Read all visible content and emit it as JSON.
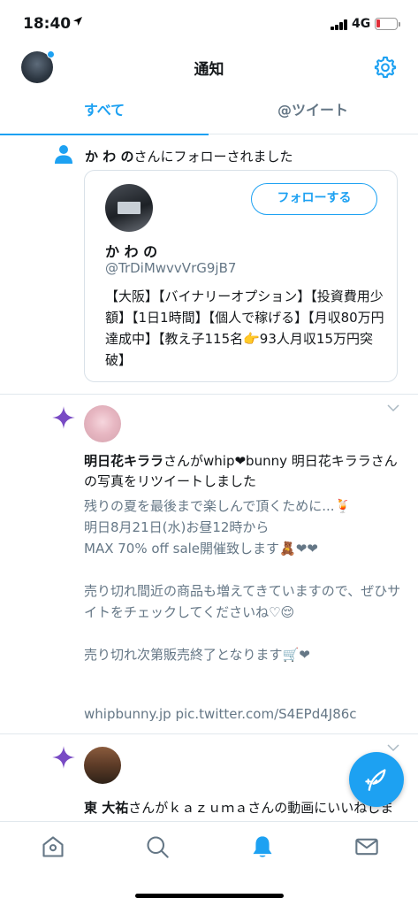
{
  "status_bar": {
    "time": "18:40",
    "network": "4G"
  },
  "header": {
    "title": "通知"
  },
  "tabs": [
    {
      "label": "すべて",
      "active": true
    },
    {
      "label": "@ツイート",
      "active": false
    }
  ],
  "notifications": [
    {
      "type": "follow",
      "user_name": "か わ の",
      "action_text": "さんにフォローされました",
      "card": {
        "name": "か わ の",
        "handle": "@TrDiMwvvVrG9jB7",
        "follow_label": "フォローする",
        "bio": "【大阪】【バイナリーオプション】【投資費用少額】【1日1時間】【個人で稼げる】【月収80万円達成中】【教え子115名👉93人月収15万円突破】"
      }
    },
    {
      "type": "retweet",
      "user_name": "明日花キララ",
      "action_text": "さんがwhip❤bunny  明日花キララさんの写真をリツイートしました",
      "lines": [
        "残りの夏を最後まで楽しんで頂くために...🍹",
        "明日8月21日(水)お昼12時から",
        "MAX 70% off sale開催致します🧸❤❤",
        "",
        "売り切れ間近の商品も増えてきていますので、ぜひサイトをチェックしてくださいね♡😌",
        "",
        "売り切れ次第販売終了となります🛒❤"
      ],
      "link": "whipbunny.jp pic.twitter.com/S4EPd4J86c"
    },
    {
      "type": "retweet",
      "user_name": "東 大祐",
      "action_text": "さんがｋａｚｕｍａさんの動画にいいねしました"
    }
  ],
  "colors": {
    "accent": "#1da1f2",
    "secondary_text": "#657786",
    "sparkle": "#794bc4",
    "divider": "#e1e8ed"
  },
  "icons": {
    "settings": "gear-icon",
    "follow_indicator": "person-icon",
    "retweet_indicator": "sparkle-icon",
    "compose": "compose-icon",
    "nav": [
      "home-icon",
      "search-icon",
      "bell-icon",
      "mail-icon"
    ]
  }
}
